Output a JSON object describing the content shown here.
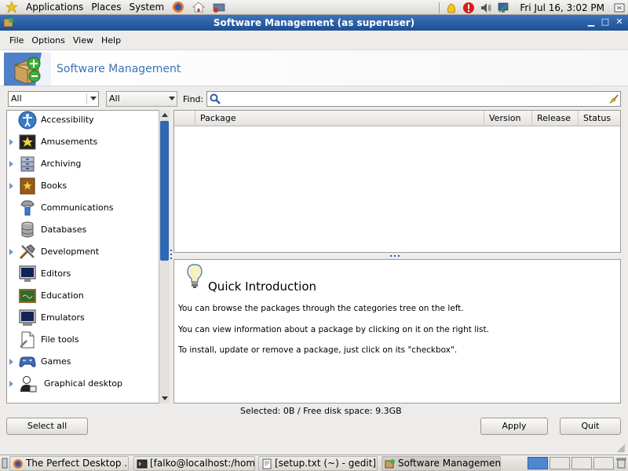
{
  "top_panel": {
    "menus": [
      "Applications",
      "Places",
      "System"
    ],
    "clock": "Fri Jul 16,  3:02 PM"
  },
  "window": {
    "title": "Software Management (as superuser)"
  },
  "menubar": [
    "File",
    "Options",
    "View",
    "Help"
  ],
  "banner": {
    "title": "Software Management"
  },
  "filters": {
    "filter1": "All",
    "filter2": "All",
    "find_label": "Find:",
    "find_value": ""
  },
  "categories": [
    {
      "label": "Accessibility",
      "expandable": false,
      "icon": "accessibility-icon"
    },
    {
      "label": "Amusements",
      "expandable": true,
      "icon": "amusements-icon"
    },
    {
      "label": "Archiving",
      "expandable": true,
      "icon": "archiving-icon"
    },
    {
      "label": "Books",
      "expandable": true,
      "icon": "books-icon"
    },
    {
      "label": "Communications",
      "expandable": false,
      "icon": "communications-icon"
    },
    {
      "label": "Databases",
      "expandable": false,
      "icon": "databases-icon"
    },
    {
      "label": "Development",
      "expandable": true,
      "icon": "development-icon"
    },
    {
      "label": "Editors",
      "expandable": false,
      "icon": "editors-icon"
    },
    {
      "label": "Education",
      "expandable": false,
      "icon": "education-icon"
    },
    {
      "label": "Emulators",
      "expandable": false,
      "icon": "emulators-icon"
    },
    {
      "label": "File tools",
      "expandable": false,
      "icon": "file-tools-icon"
    },
    {
      "label": "Games",
      "expandable": true,
      "icon": "games-icon"
    },
    {
      "label": "Graphical desktop",
      "expandable": true,
      "icon": "graphical-desktop-icon"
    }
  ],
  "package_table": {
    "columns": [
      "Package",
      "Version",
      "Release",
      "Status"
    ]
  },
  "intro": {
    "heading": "Quick Introduction",
    "lines": [
      "You can browse the packages through the categories tree on the left.",
      "You can view information about a package by clicking on it on the right list.",
      "To install, update or remove a package, just click on its \"checkbox\"."
    ]
  },
  "status": "Selected: 0B / Free disk space: 9.3GB",
  "buttons": {
    "select_all": "Select all",
    "apply": "Apply",
    "quit": "Quit"
  },
  "taskbar": [
    "The Perfect Desktop ...",
    "[falko@localhost:/hom...",
    "[setup.txt (~) - gedit]",
    "Software Managemen..."
  ]
}
